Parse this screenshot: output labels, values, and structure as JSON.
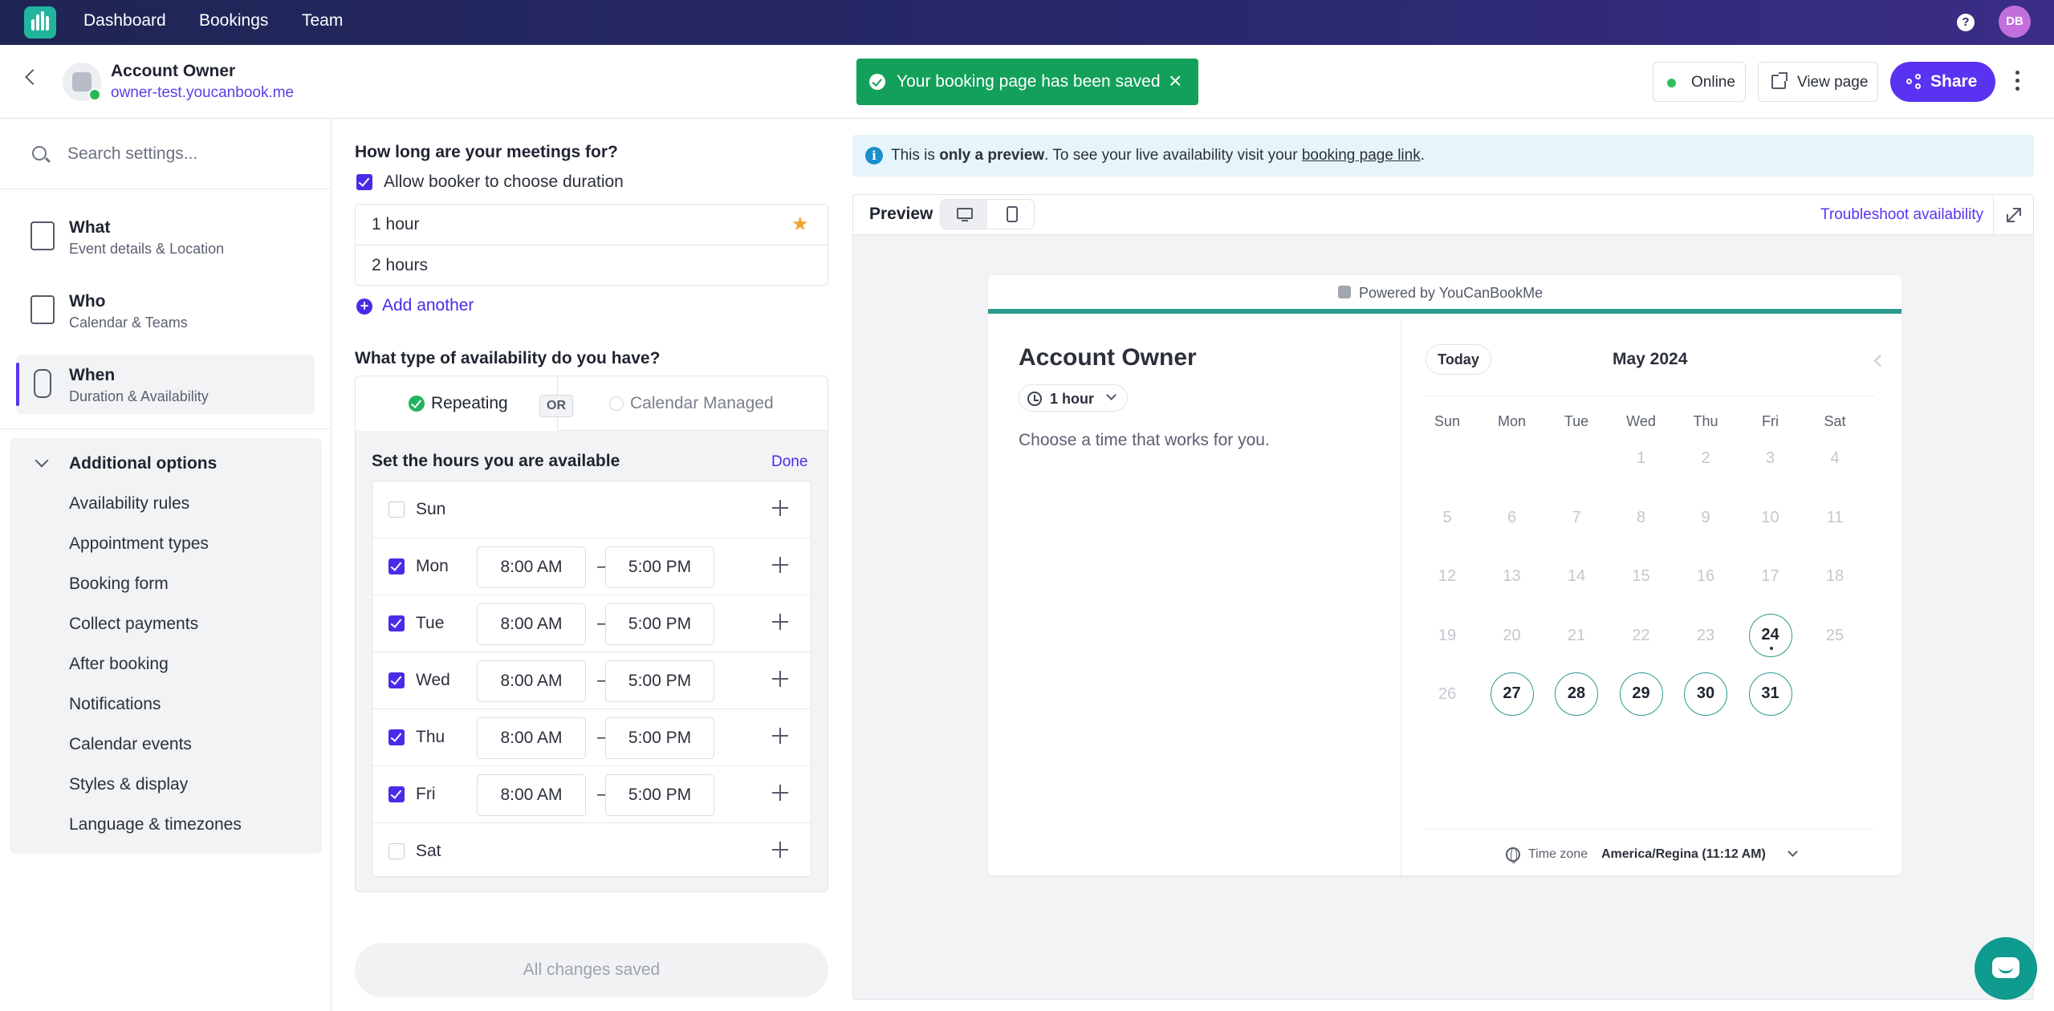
{
  "nav": {
    "items": [
      "Dashboard",
      "Bookings",
      "Team"
    ],
    "user_initials": "DB"
  },
  "header": {
    "account_name": "Account Owner",
    "account_url": "owner-test.youcanbook.me",
    "toast_message": "Your booking page has been saved",
    "online_label": "Online",
    "view_page_label": "View page",
    "share_label": "Share"
  },
  "sidebar": {
    "search_placeholder": "Search settings...",
    "sections": [
      {
        "title": "What",
        "subtitle": "Event details & Location",
        "icon": "clipboard-icon"
      },
      {
        "title": "Who",
        "subtitle": "Calendar & Teams",
        "icon": "contact-card-icon"
      },
      {
        "title": "When",
        "subtitle": "Duration & Availability",
        "icon": "watch-icon"
      }
    ],
    "active_section": "When",
    "additional": {
      "title": "Additional options",
      "options": [
        "Availability rules",
        "Appointment types",
        "Booking form",
        "Collect payments",
        "After booking",
        "Notifications",
        "Calendar events",
        "Styles & display",
        "Language & timezones"
      ]
    }
  },
  "form": {
    "duration_question": "How long are your meetings for?",
    "allow_choose_label": "Allow booker to choose duration",
    "allow_choose_checked": true,
    "durations": [
      "1 hour",
      "2 hours"
    ],
    "default_duration": "1 hour",
    "add_another_label": "Add another",
    "availability_question": "What type of availability do you have?",
    "tab_repeating": "Repeating",
    "tab_or": "OR",
    "tab_calendar_managed": "Calendar Managed",
    "hours_title": "Set the hours you are available",
    "done_label": "Done",
    "days": [
      {
        "day": "Sun",
        "checked": false,
        "start": "",
        "end": ""
      },
      {
        "day": "Mon",
        "checked": true,
        "start": "8:00 AM",
        "end": "5:00 PM"
      },
      {
        "day": "Tue",
        "checked": true,
        "start": "8:00 AM",
        "end": "5:00 PM"
      },
      {
        "day": "Wed",
        "checked": true,
        "start": "8:00 AM",
        "end": "5:00 PM"
      },
      {
        "day": "Thu",
        "checked": true,
        "start": "8:00 AM",
        "end": "5:00 PM"
      },
      {
        "day": "Fri",
        "checked": true,
        "start": "8:00 AM",
        "end": "5:00 PM"
      },
      {
        "day": "Sat",
        "checked": false,
        "start": "",
        "end": ""
      }
    ],
    "time_separator": "–",
    "saved_label": "All changes saved"
  },
  "preview": {
    "info_prefix": "This is ",
    "info_bold": "only a preview",
    "info_middle": ". To see your live availability visit your ",
    "info_link": "booking page link",
    "info_suffix": ".",
    "title": "Preview",
    "troubleshoot_label": "Troubleshoot availability",
    "powered_by": "Powered by YouCanBookMe",
    "card_name": "Account Owner",
    "duration_select": "1 hour",
    "choose_text": "Choose a time that works for you.",
    "today_label": "Today",
    "month_label": "May 2024",
    "weekdays": [
      "Sun",
      "Mon",
      "Tue",
      "Wed",
      "Thu",
      "Fri",
      "Sat"
    ],
    "first_weekday_index": 3,
    "days_in_month": 31,
    "available_days": [
      24,
      27,
      28,
      29,
      30,
      31
    ],
    "today": 24,
    "timezone_label": "Time zone",
    "timezone_value": "America/Regina (11:12 AM)"
  },
  "colors": {
    "brand": "#5a32f2",
    "teal": "#2a9b8c",
    "success": "#13a05a"
  }
}
